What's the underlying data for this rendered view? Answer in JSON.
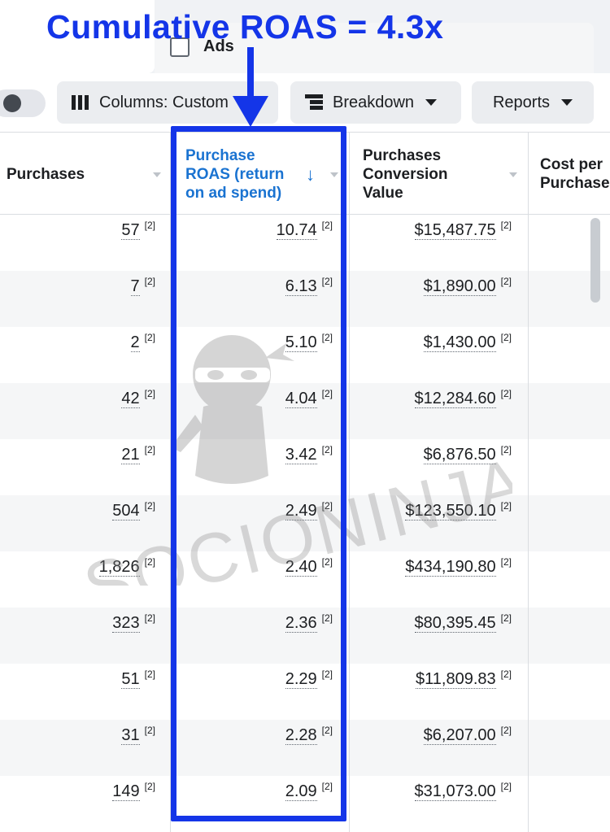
{
  "annotation": {
    "title": "Cumulative ROAS = 4.3x",
    "color": "#1435e8"
  },
  "tabs": {
    "ads_label": "Ads"
  },
  "toolbar": {
    "columns_label": "Columns: Custom",
    "breakdown_label": "Breakdown",
    "reports_label": "Reports"
  },
  "table": {
    "headers": {
      "purchases": "Purchases",
      "roas_line1": "Purchase",
      "roas_line2": "ROAS (return",
      "roas_line3": "on ad spend)",
      "conv_line1": "Purchases",
      "conv_line2": "Conversion",
      "conv_line3": "Value",
      "cost_line1": "Cost per",
      "cost_line2": "Purchase"
    },
    "footnote_mark": "[2]",
    "rows": [
      {
        "purchases": "57",
        "roas": "10.74",
        "value": "$15,487.75"
      },
      {
        "purchases": "7",
        "roas": "6.13",
        "value": "$1,890.00"
      },
      {
        "purchases": "2",
        "roas": "5.10",
        "value": "$1,430.00"
      },
      {
        "purchases": "42",
        "roas": "4.04",
        "value": "$12,284.60"
      },
      {
        "purchases": "21",
        "roas": "3.42",
        "value": "$6,876.50"
      },
      {
        "purchases": "504",
        "roas": "2.49",
        "value": "$123,550.10"
      },
      {
        "purchases": "1,826",
        "roas": "2.40",
        "value": "$434,190.80"
      },
      {
        "purchases": "323",
        "roas": "2.36",
        "value": "$80,395.45"
      },
      {
        "purchases": "51",
        "roas": "2.29",
        "value": "$11,809.83"
      },
      {
        "purchases": "31",
        "roas": "2.28",
        "value": "$6,207.00"
      },
      {
        "purchases": "149",
        "roas": "2.09",
        "value": "$31,073.00"
      }
    ]
  },
  "watermark": {
    "text": "SOCIONINJA"
  },
  "colors": {
    "accent_blue": "#1a73d1",
    "annotation_blue": "#1435e8",
    "row_alt": "#f5f6f7"
  }
}
